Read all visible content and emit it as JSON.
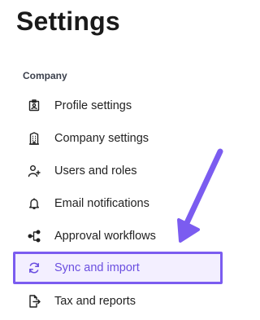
{
  "page": {
    "title": "Settings"
  },
  "section": {
    "label": "Company"
  },
  "nav": {
    "items": [
      {
        "label": "Profile settings",
        "icon": "id-badge-icon"
      },
      {
        "label": "Company settings",
        "icon": "building-icon"
      },
      {
        "label": "Users and roles",
        "icon": "user-plus-icon"
      },
      {
        "label": "Email notifications",
        "icon": "bell-icon"
      },
      {
        "label": "Approval workflows",
        "icon": "workflow-icon"
      },
      {
        "label": "Sync and import",
        "icon": "sync-icon",
        "active": true
      },
      {
        "label": "Tax and reports",
        "icon": "file-export-icon"
      }
    ]
  },
  "colors": {
    "accent": "#7b5cf0",
    "active_bg": "#f3efff",
    "active_text": "#6b4fe0",
    "text": "#222222"
  }
}
